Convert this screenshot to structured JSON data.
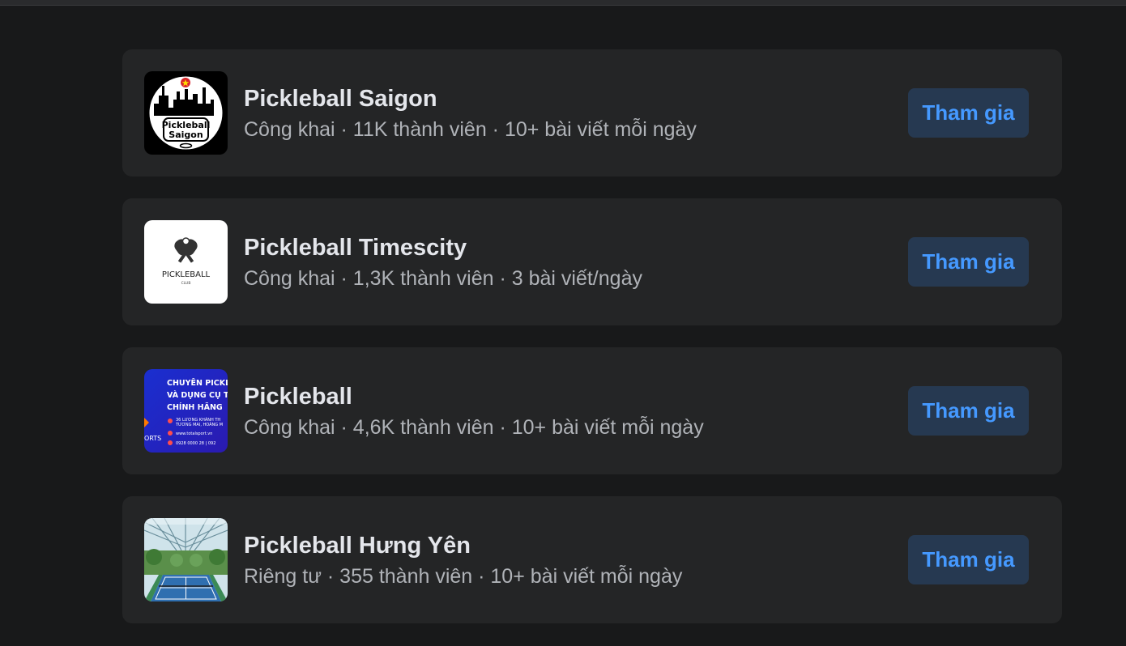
{
  "groups": [
    {
      "name": "Pickleball Saigon",
      "meta": "Công khai · 11K thành viên · 10+ bài viết mỗi ngày",
      "join_label": "Tham gia",
      "avatar_text": [
        "Pickleball",
        "Saigon"
      ]
    },
    {
      "name": "Pickleball Timescity",
      "meta": "Công khai · 1,3K thành viên · 3 bài viết/ngày",
      "join_label": "Tham gia",
      "avatar_text": [
        "PICKLEBALL",
        "CLUB"
      ]
    },
    {
      "name": "Pickleball",
      "meta": "Công khai · 4,6K thành viên · 10+ bài viết mỗi ngày",
      "join_label": "Tham gia",
      "avatar_text": [
        "CHUYÊN PICKLE",
        "VÀ DỤNG CỤ TH",
        "CHÍNH HÃNG",
        "36 LƯƠNG KHÁNH TH",
        "TƯƠNG MAI, HOÀNG M",
        "www.totalsport.vn",
        "0928 0000 28 | 092",
        "ORTS"
      ]
    },
    {
      "name": "Pickleball Hưng Yên",
      "meta": "Riêng tư · 355 thành viên · 10+ bài viết mỗi ngày",
      "join_label": "Tham gia"
    }
  ],
  "colors": {
    "background": "#18191a",
    "card": "#242526",
    "title": "#e4e6eb",
    "meta": "#b0b3b8",
    "join_bg": "#263951",
    "join_text": "#4599ff"
  }
}
